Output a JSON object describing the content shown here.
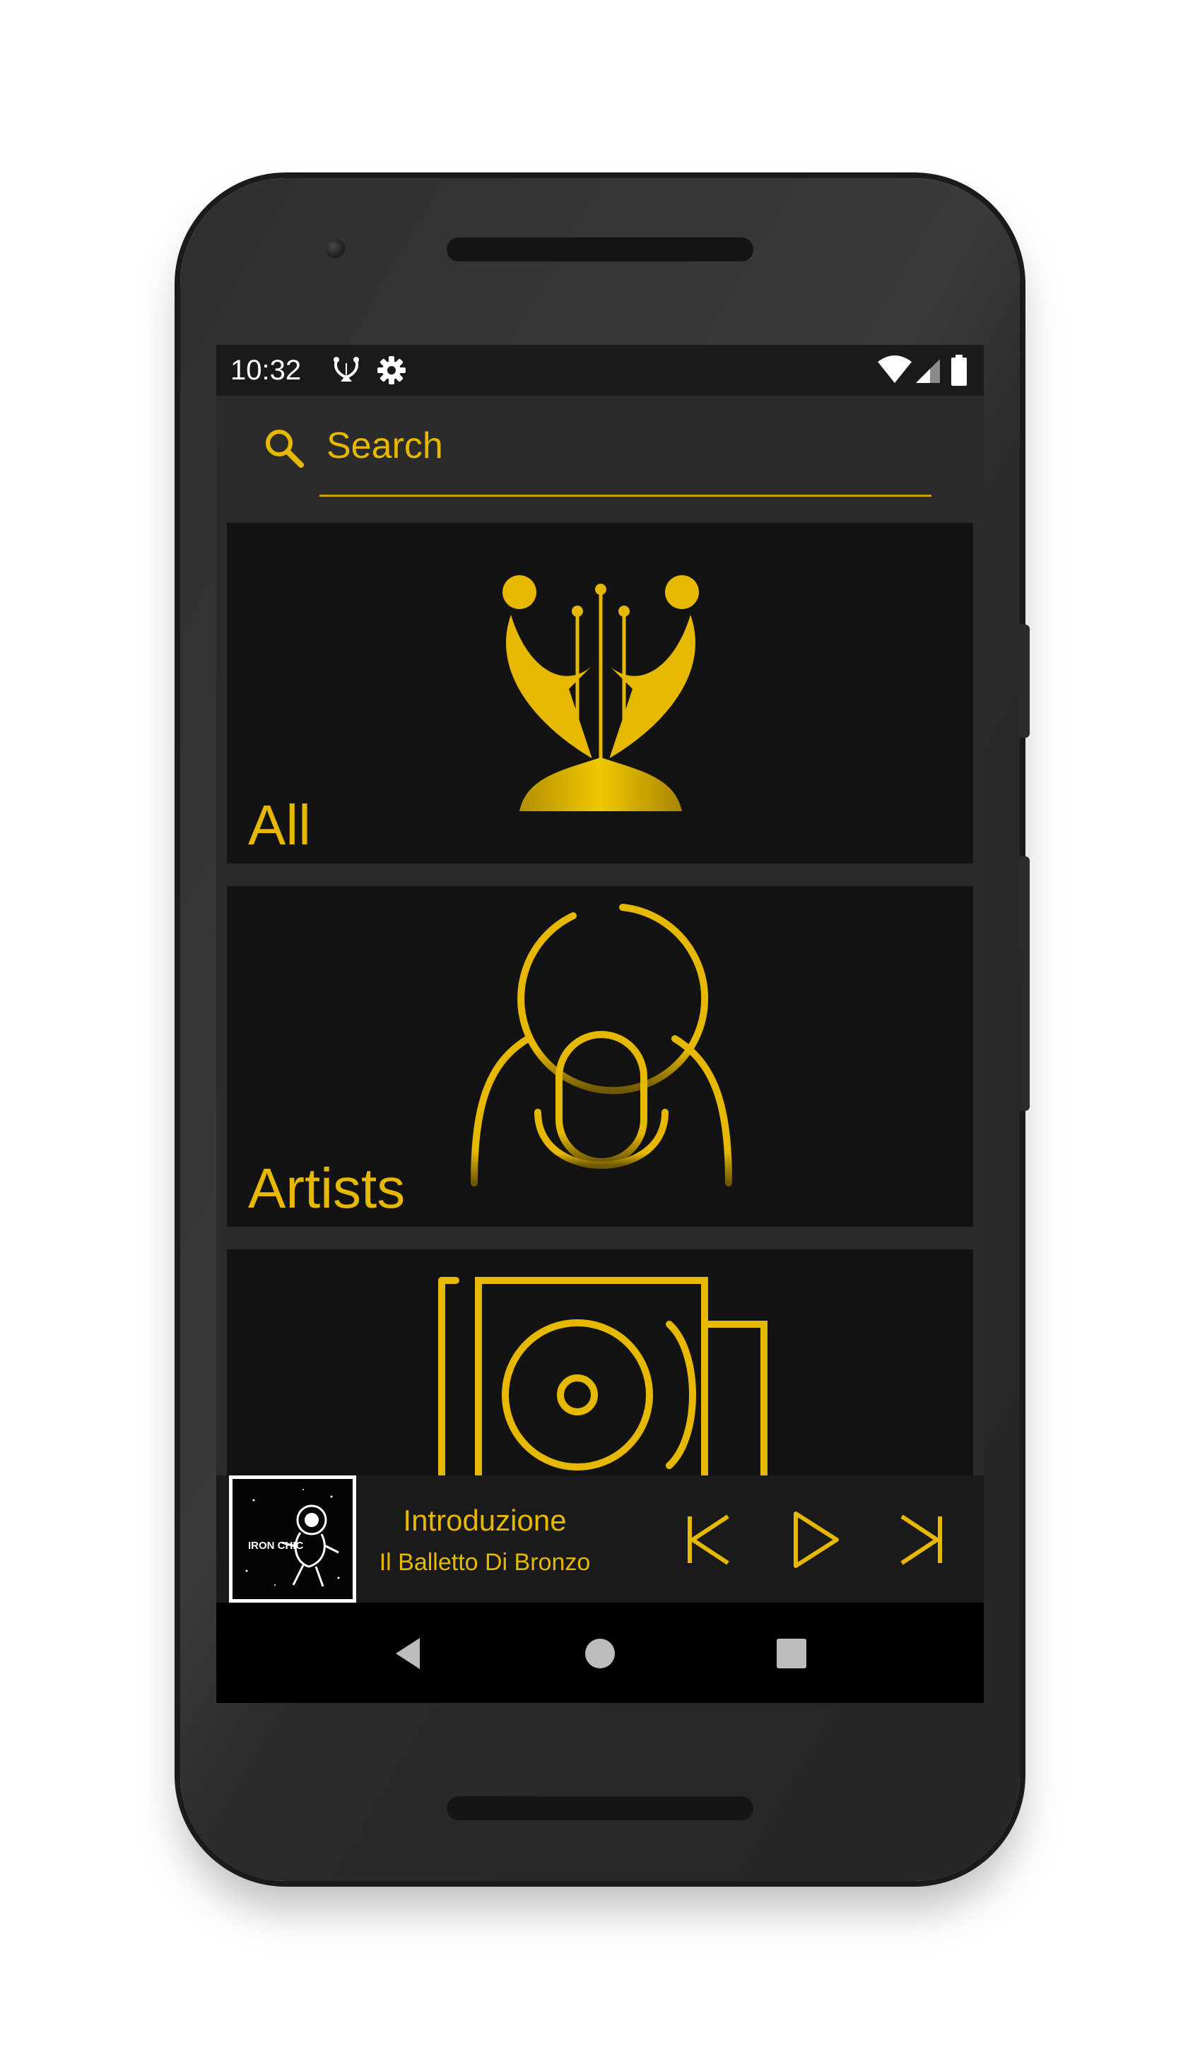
{
  "status_bar": {
    "time": "10:32",
    "icons": [
      "lyre-app-icon",
      "gear-icon",
      "wifi-icon",
      "signal-icon",
      "battery-icon"
    ]
  },
  "search": {
    "placeholder": "Search",
    "icon": "search-icon"
  },
  "categories": [
    {
      "label": "All",
      "icon": "lyre-icon"
    },
    {
      "label": "Artists",
      "icon": "microphone-person-icon"
    },
    {
      "label": "",
      "icon": "album-disc-icon"
    }
  ],
  "player": {
    "album_art_text": "IRON CHIC",
    "title": "Introduzione",
    "artist": "Il Balletto Di Bronzo",
    "controls": [
      "skip-previous-icon",
      "play-icon",
      "skip-next-icon"
    ]
  },
  "nav": [
    "back-icon",
    "home-icon",
    "recents-icon"
  ],
  "colors": {
    "accent": "#e6b800",
    "background": "#2b2b2b",
    "card": "#131313",
    "player_bg": "#1a1a1a"
  }
}
